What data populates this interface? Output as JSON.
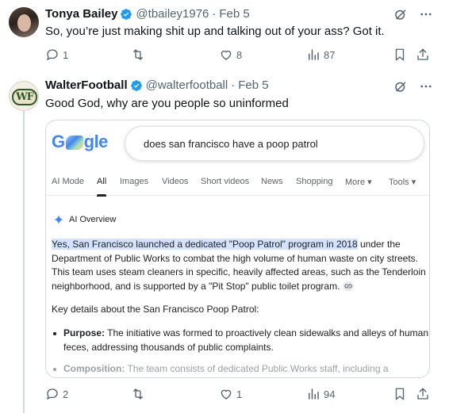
{
  "tweet1": {
    "name": "Tonya Bailey",
    "handle": "@tbailey1976",
    "separator": "·",
    "date": "Feb 5",
    "text": "So, you’re just making shit up and talking out of your ass? Got it.",
    "stats": {
      "replies": "1",
      "retweets": "",
      "likes": "8",
      "views": "87"
    }
  },
  "tweet2": {
    "name": "WalterFootball",
    "handle": "@walterfootball",
    "separator": "·",
    "date": "Feb 5",
    "avatar_text": "WF",
    "text": "Good God, why are you people so uninformed",
    "stats": {
      "replies": "2",
      "retweets": "",
      "likes": "1",
      "views": "94"
    },
    "card": {
      "logo": {
        "part1": "G",
        "part2": "gle"
      },
      "search_query": "does san francisco have a poop patrol",
      "tabs": [
        "AI Mode",
        "All",
        "Images",
        "Videos",
        "Short videos",
        "News",
        "Shopping",
        "More ▾",
        "Tools ▾"
      ],
      "active_tab": "All",
      "ai_overview_label": "AI Overview",
      "paragraph": {
        "highlighted": "Yes, San Francisco launched a dedicated \"Poop Patrol\" program in 2018",
        "line1_rest": " under the",
        "line2": "Department of Public Works to combat the high volume of human waste on city streets.",
        "line3": "This team uses steam cleaners in specific, heavily affected areas, such as the Tenderloin",
        "line4": "neighborhood, and is supported by a \"Pit Stop\" public toilet program."
      },
      "key_details": "Key details about the San Francisco Poop Patrol:",
      "bullets": [
        {
          "label": "Purpose:",
          "line1": " The initiative was formed to proactively clean sidewalks and alleys of human",
          "line2": "feces, addressing thousands of public complaints."
        },
        {
          "label": "Composition:",
          "line1": " The team consists of dedicated Public Works staff, including a",
          "line2": ""
        }
      ]
    }
  },
  "colors": {
    "verified": "#1d9bf0",
    "text_primary": "#0f1419",
    "text_secondary": "#536471",
    "highlight": "#d3e3fd",
    "ai_sparkle": "#4285f4"
  },
  "icons": [
    "verified-badge-icon",
    "grok-icon",
    "more-icon",
    "reply-icon",
    "retweet-icon",
    "like-icon",
    "views-icon",
    "bookmark-icon",
    "share-icon",
    "ai-sparkle-icon",
    "link-icon"
  ]
}
